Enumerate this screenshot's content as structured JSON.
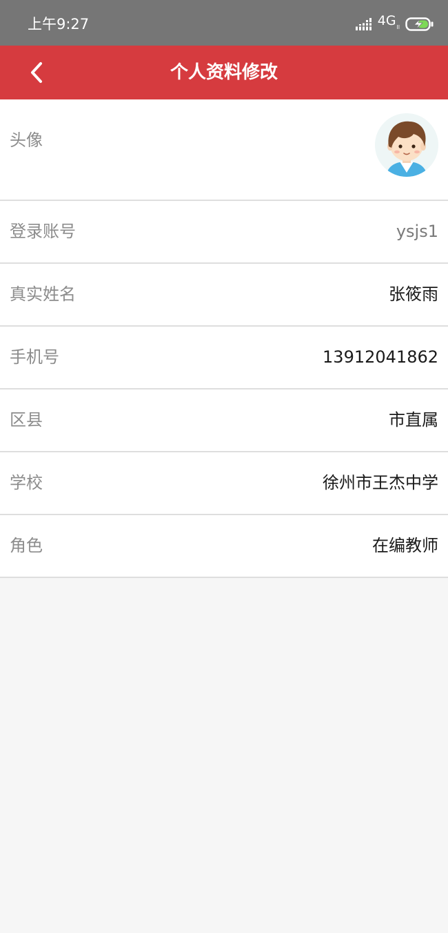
{
  "status_bar": {
    "time": "上午9:27",
    "network": "4G",
    "network_sub": "ll",
    "icons": [
      "signal-icon",
      "battery-charging-icon"
    ]
  },
  "header": {
    "title": "个人资料修改",
    "back_icon": "chevron-left-icon",
    "background_color": "#d63b3f"
  },
  "profile": {
    "avatar": {
      "label": "头像",
      "icon": "boy-avatar-icon"
    },
    "fields": [
      {
        "label": "登录账号",
        "value": "ysjs1"
      },
      {
        "label": "真实姓名",
        "value": "张筱雨"
      },
      {
        "label": "手机号",
        "value": "13912041862"
      },
      {
        "label": "区县",
        "value": "市直属"
      },
      {
        "label": "学校",
        "value": "徐州市王杰中学"
      },
      {
        "label": "角色",
        "value": "在编教师"
      }
    ]
  }
}
